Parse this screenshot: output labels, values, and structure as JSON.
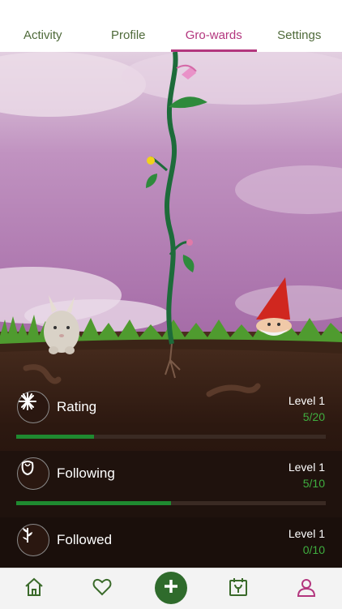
{
  "tabs": [
    {
      "label": "Activity"
    },
    {
      "label": "Profile"
    },
    {
      "label": "Gro-wards"
    },
    {
      "label": "Settings"
    }
  ],
  "stats": [
    {
      "label": "Rating",
      "level": "Level 1",
      "progress": "5/20",
      "fill": 0.25,
      "icon": "asterisk-flower-icon"
    },
    {
      "label": "Following",
      "level": "Level 1",
      "progress": "5/10",
      "fill": 0.5,
      "icon": "tulip-icon"
    },
    {
      "label": "Followed",
      "level": "Level 1",
      "progress": "0/10",
      "fill": 0.0,
      "icon": "sprout-icon"
    }
  ],
  "nav": [
    {
      "icon": "home-icon"
    },
    {
      "icon": "heart-icon"
    },
    {
      "icon": "plus-icon"
    },
    {
      "icon": "calendar-plant-icon"
    },
    {
      "icon": "profile-icon"
    }
  ],
  "colors": {
    "accent": "#b3367e",
    "green": "#2f6b2c",
    "progress": "#1f8a30",
    "soil": "#2a1710",
    "sky": "#b07ab0"
  }
}
